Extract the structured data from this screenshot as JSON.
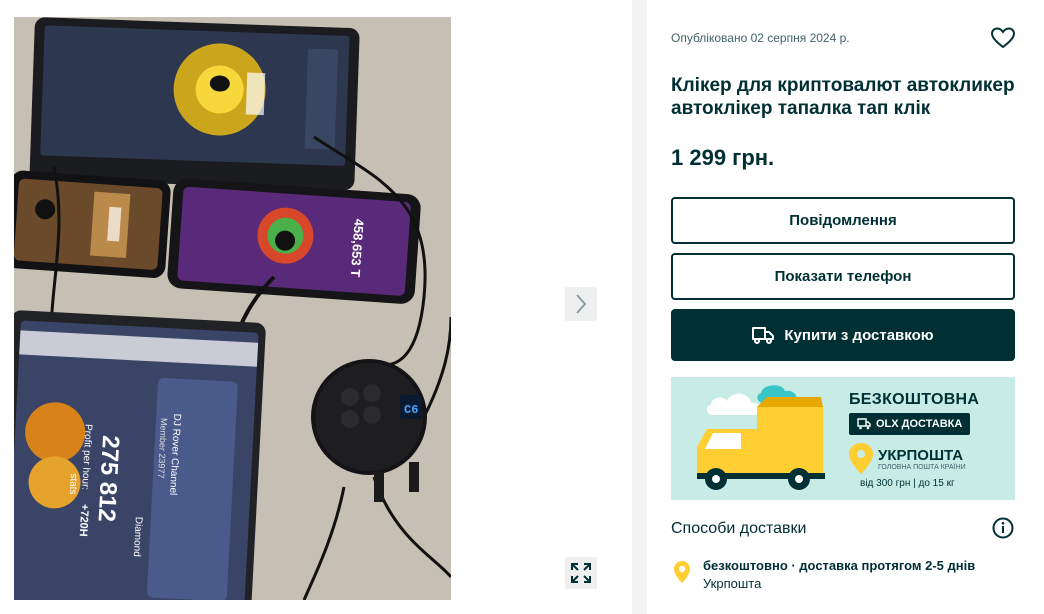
{
  "gallery": {
    "phone_counter_1": "458,653 T",
    "tablet_counter_1": "275 812",
    "tablet_profit_label": "Profit per hour:",
    "tablet_profit_value": "+720H",
    "tablet_channel": "DJ Rover Channel",
    "tablet_member": "Member 23977",
    "tablet_rank": "Diamond",
    "tablet_stats": "stats",
    "hub_display": "C6"
  },
  "listing": {
    "posted": "Опубліковано 02 серпня 2024 р.",
    "title": "Клікер для криптовалют автокликер автоклікер тапалка тап клік",
    "price": "1 299 грн."
  },
  "actions": {
    "message_label": "Повідомлення",
    "phone_label": "Показати телефон",
    "buy_label": "Купити з доставкою"
  },
  "banner": {
    "free": "БЕЗКОШТОВНА",
    "badge": "OLX ДОСТАВКА",
    "carrier": "УКРПОШТА",
    "carrier_sub": "ГОЛОВНА ПОШТА КРАЇНИ",
    "range": "від 300 грн | до 15 кг"
  },
  "delivery": {
    "title": "Способи доставки",
    "line1": "безкоштовно · доставка протягом 2-5 днів",
    "line2": "Укрпошта"
  },
  "colors": {
    "primary": "#002f34",
    "banner_bg": "#c7ece6",
    "truck_yellow": "#ffce32",
    "pin_yellow": "#ffce32"
  }
}
